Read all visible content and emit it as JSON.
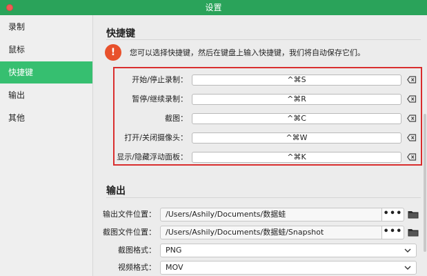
{
  "window": {
    "title": "设置"
  },
  "sidebar": {
    "items": [
      {
        "label": "录制"
      },
      {
        "label": "鼠标"
      },
      {
        "label": "快捷键",
        "active": true
      },
      {
        "label": "输出"
      },
      {
        "label": "其他"
      }
    ]
  },
  "hotkeys": {
    "title": "快捷键",
    "notice": "您可以选择快捷键，然后在键盘上输入快捷键，我们将自动保存它们。",
    "items": [
      {
        "label": "开始/停止录制：",
        "value": "^⌘S"
      },
      {
        "label": "暂停/继续录制：",
        "value": "^⌘R"
      },
      {
        "label": "截图：",
        "value": "^⌘C"
      },
      {
        "label": "打开/关闭摄像头：",
        "value": "^⌘W"
      },
      {
        "label": "显示/隐藏浮动面板：",
        "value": "^⌘K"
      }
    ]
  },
  "output": {
    "title": "输出",
    "file_location": {
      "label": "输出文件位置：",
      "value": "/Users/Ashily/Documents/数据蛙",
      "more": "•••"
    },
    "screenshot_location": {
      "label": "截图文件位置：",
      "value": "/Users/Ashily/Documents/数据蛙/Snapshot",
      "more": "•••"
    },
    "screenshot_format": {
      "label": "截图格式：",
      "value": "PNG"
    },
    "video_format": {
      "label": "视频格式：",
      "value": "MOV"
    }
  },
  "colors": {
    "accent": "#36bf70",
    "titlebar": "#2aa35a",
    "highlight_border": "#d92d2d",
    "warning": "#e8512c"
  }
}
